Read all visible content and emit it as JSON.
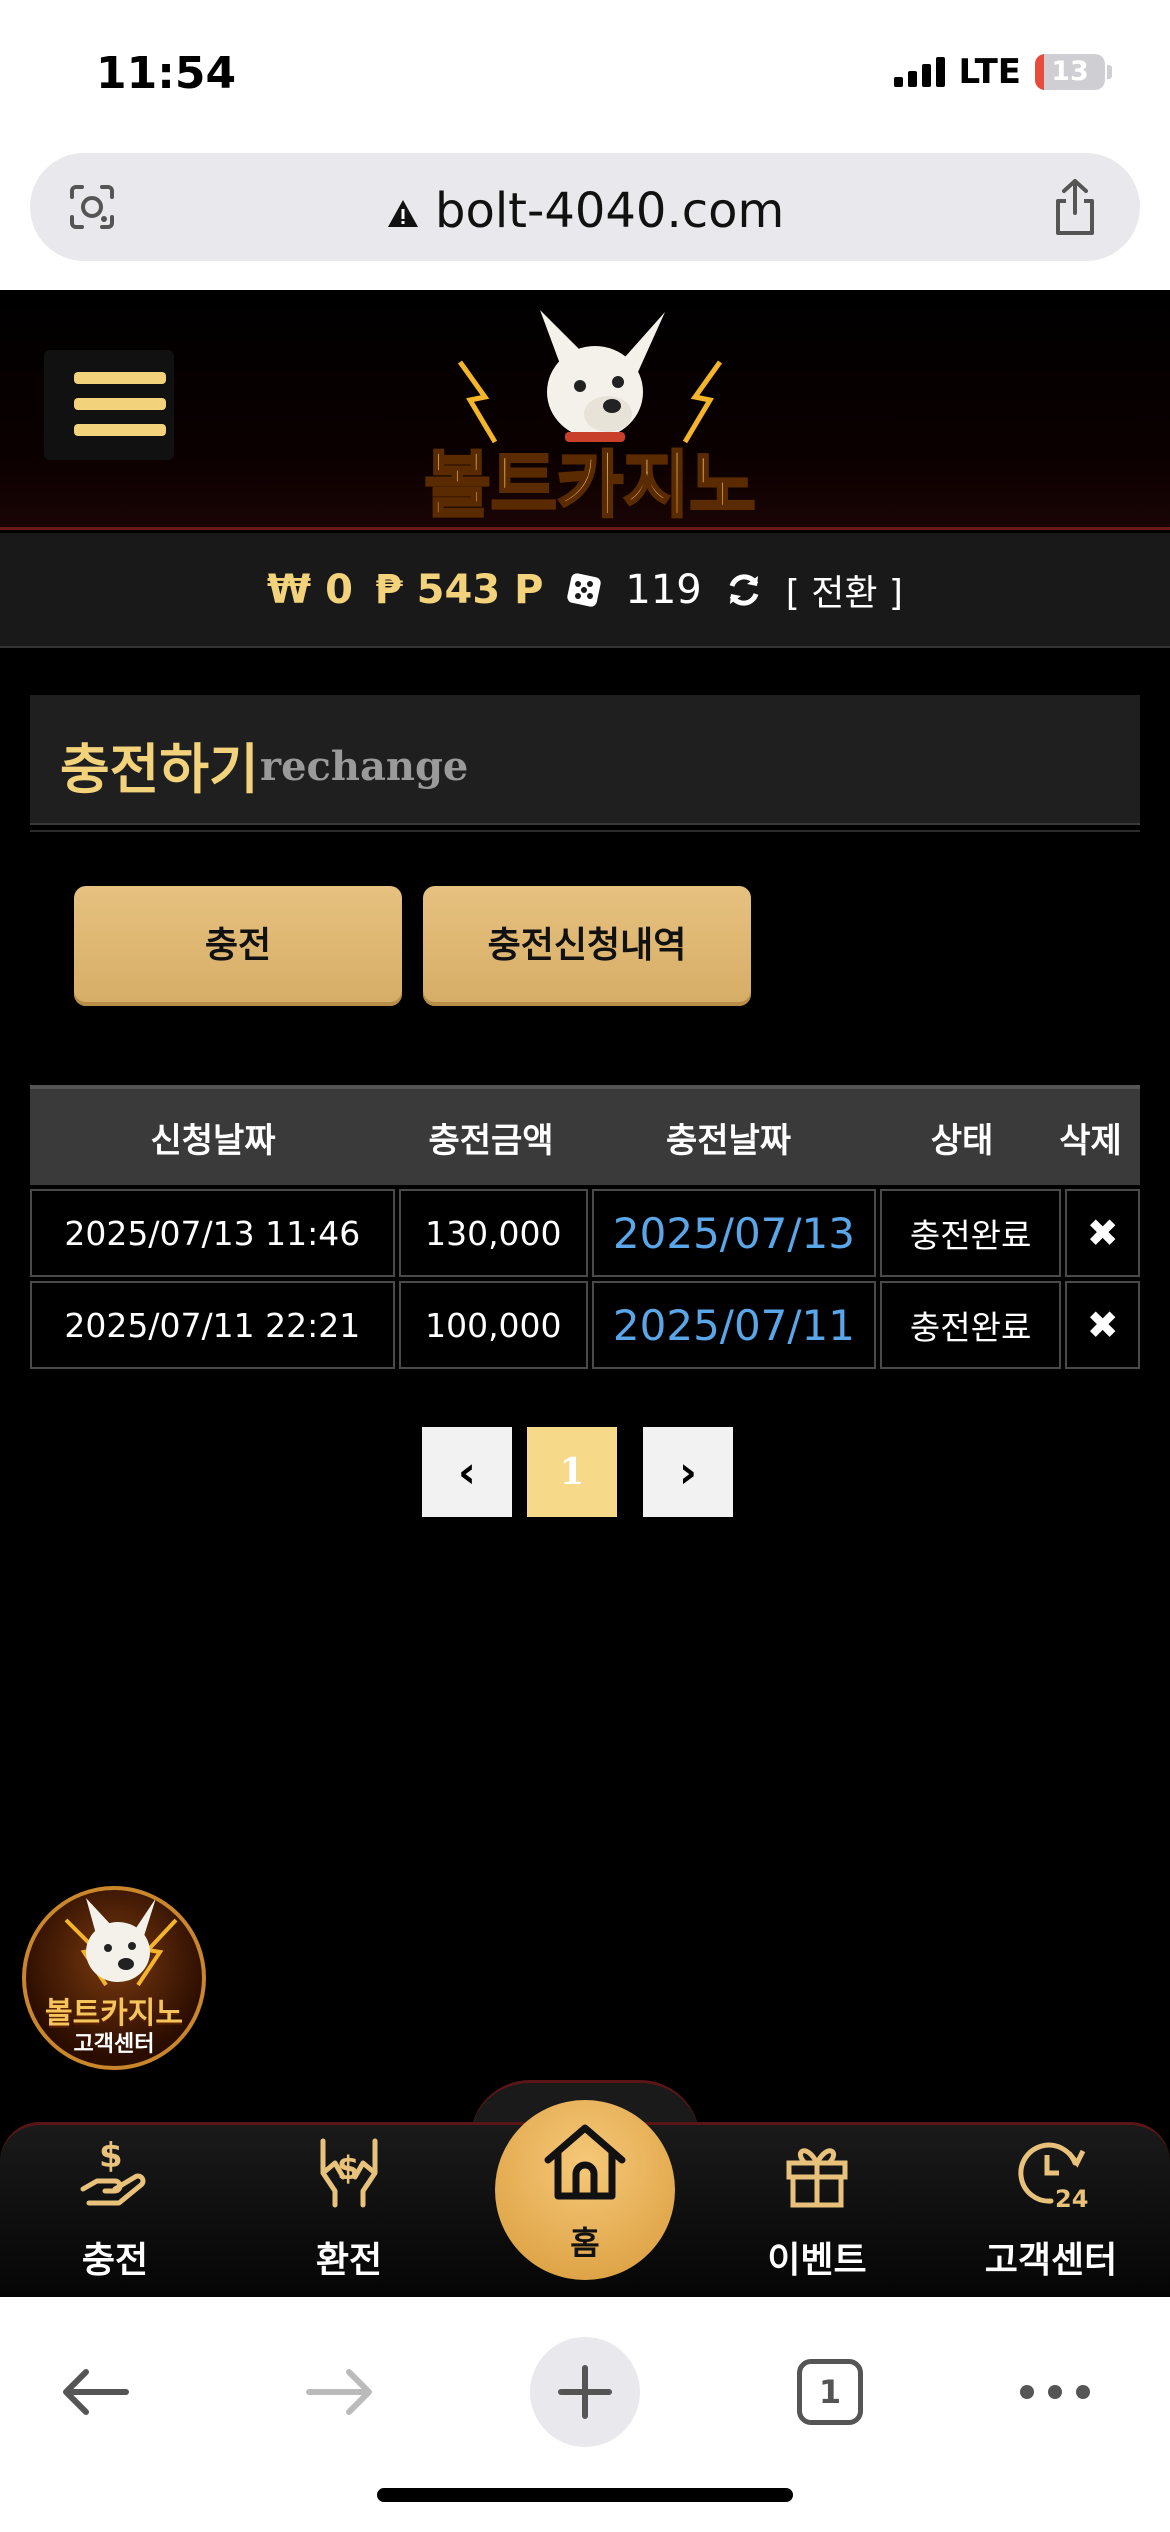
{
  "status_bar": {
    "time": "11:54",
    "network": "LTE",
    "battery": "13",
    "battery_level": 0.13
  },
  "browser": {
    "url": "bolt-4040.com",
    "tab_count": "1"
  },
  "site": {
    "logo_text": "볼트카지노",
    "balance": {
      "won": "₩ 0",
      "points": "₱ 543 P",
      "dice": "119",
      "convert_label": "[ 전환 ]"
    }
  },
  "section": {
    "title_ko": "충전하기",
    "title_en": "rechange"
  },
  "buttons": {
    "charge": "충전",
    "history": "충전신청내역"
  },
  "table": {
    "headers": [
      "신청날짜",
      "충전금액",
      "충전날짜",
      "상태",
      "삭제"
    ],
    "rows": [
      {
        "request_date": "2025/07/13 11:46",
        "amount": "130,000",
        "charge_date": "2025/07/13",
        "status": "충전완료",
        "delete": "✖"
      },
      {
        "request_date": "2025/07/11 22:21",
        "amount": "100,000",
        "charge_date": "2025/07/11",
        "status": "충전완료",
        "delete": "✖"
      }
    ]
  },
  "pagination": {
    "prev": "‹",
    "current": "1",
    "next": "›"
  },
  "cs_badge": {
    "title": "볼트카지노",
    "subtitle": "고객센터"
  },
  "bottom_nav": {
    "items": [
      {
        "label": "충전",
        "icon": "deposit-hand-icon"
      },
      {
        "label": "환전",
        "icon": "exchange-hand-icon"
      },
      {
        "label": "홈",
        "icon": "home-icon"
      },
      {
        "label": "이벤트",
        "icon": "gift-icon"
      },
      {
        "label": "고객센터",
        "icon": "support-24-icon"
      }
    ]
  },
  "colors": {
    "gold": "#f2d27a",
    "button_gold": "#dcb56f",
    "link_blue": "#5aa6e8",
    "bg": "#000000"
  }
}
